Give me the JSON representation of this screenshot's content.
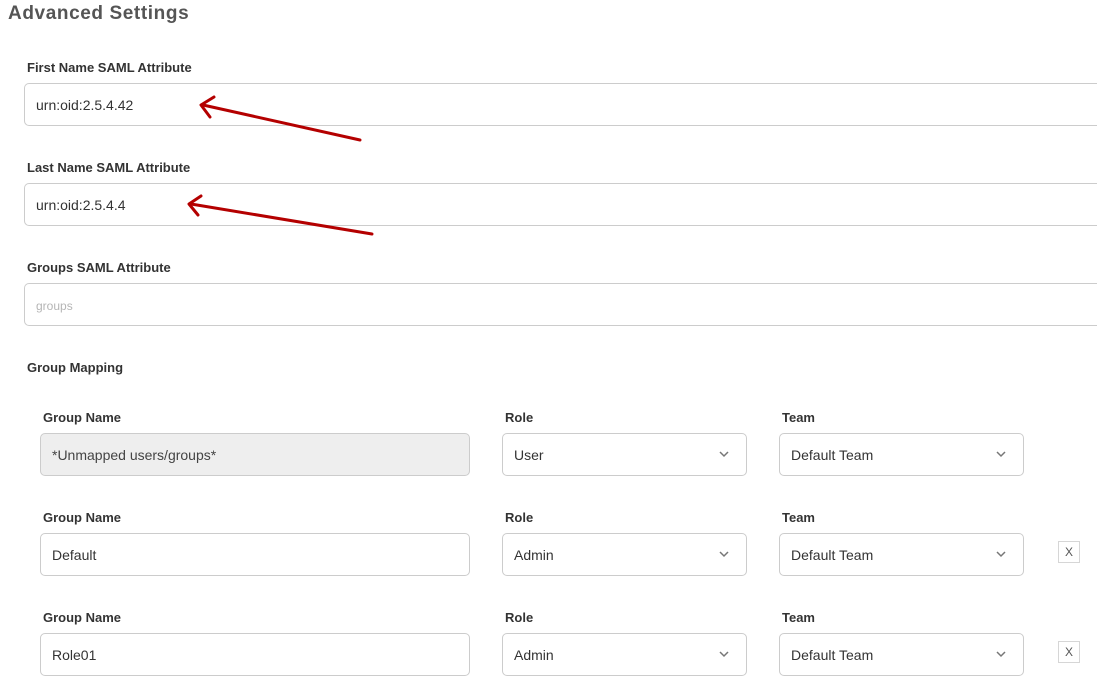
{
  "page": {
    "title": "Advanced Settings"
  },
  "saml": {
    "first_name": {
      "label": "First Name SAML Attribute",
      "value": "urn:oid:2.5.4.42"
    },
    "last_name": {
      "label": "Last Name SAML Attribute",
      "value": "urn:oid:2.5.4.4"
    },
    "groups": {
      "label": "Groups SAML Attribute",
      "value": "",
      "placeholder": "groups"
    }
  },
  "group_mapping": {
    "label": "Group Mapping",
    "column_labels": {
      "group_name": "Group Name",
      "role": "Role",
      "team": "Team"
    },
    "rows": [
      {
        "group_name": "*Unmapped users/groups*",
        "role": "User",
        "team": "Default Team",
        "removable": false,
        "editable": false
      },
      {
        "group_name": "Default",
        "role": "Admin",
        "team": "Default Team",
        "removable": true,
        "editable": true
      },
      {
        "group_name": "Role01",
        "role": "Admin",
        "team": "Default Team",
        "removable": true,
        "editable": true
      }
    ],
    "remove_label": "X"
  },
  "icons": {
    "dropdown": "chevron-down-icon"
  },
  "colors": {
    "annotation_arrow": "#b40000",
    "input_border": "#cccccc",
    "disabled_fill": "#eeeeee"
  }
}
